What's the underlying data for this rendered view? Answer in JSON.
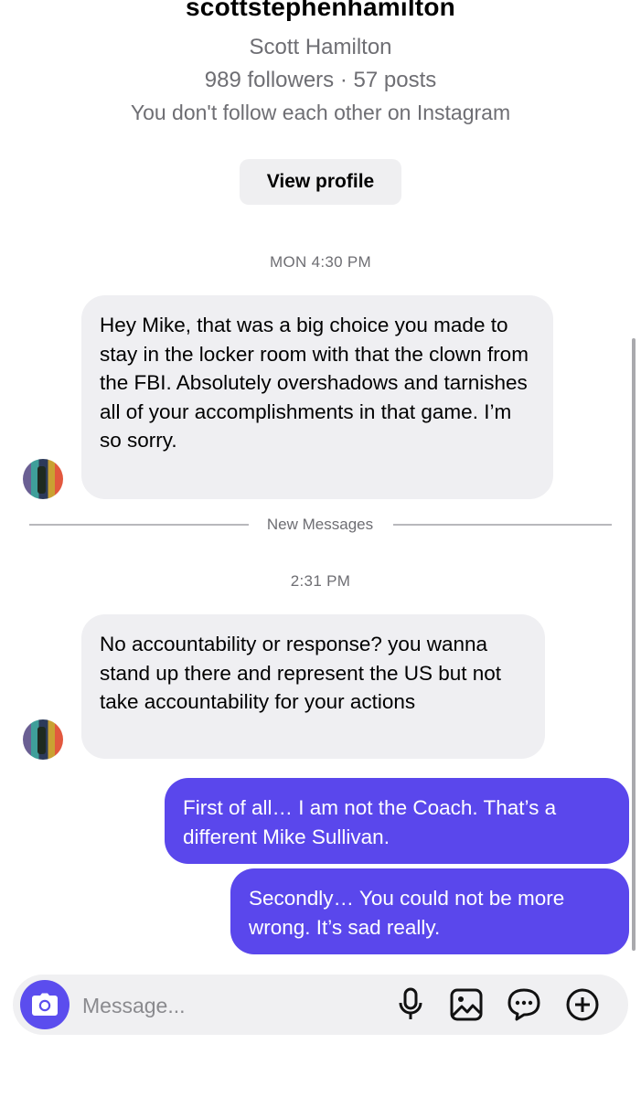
{
  "profile": {
    "username": "scottstephenhamilton",
    "full_name": "Scott Hamilton",
    "stats": "989 followers · 57 posts",
    "follow_status": "You don't follow each other on Instagram",
    "view_profile_label": "View profile"
  },
  "thread": {
    "timestamp_1": "MON 4:30 PM",
    "message_1": "Hey Mike, that was a big choice you made to stay in the locker room with that the clown from the FBI. Absolutely overshadows and tarnishes all of your accomplishments in that game. I’m so sorry.",
    "divider_label": "New Messages",
    "timestamp_2": "2:31 PM",
    "message_2": "No accountability or response? you wanna stand up there and represent the US but not take accountability for your actions",
    "reply_1": "First of all… I am not the Coach. That’s a different Mike Sullivan.",
    "reply_2": "Secondly… You could not be more wrong. It’s sad really."
  },
  "composer": {
    "placeholder": "Message...",
    "icons": [
      "camera-icon",
      "microphone-icon",
      "gallery-icon",
      "sticker-icon",
      "plus-icon"
    ]
  },
  "colors": {
    "outgoing_bubble": "#5a47ec",
    "incoming_bubble": "#efeff2",
    "camera_button": "#5b4dee",
    "secondary_text": "#6e6e73"
  }
}
